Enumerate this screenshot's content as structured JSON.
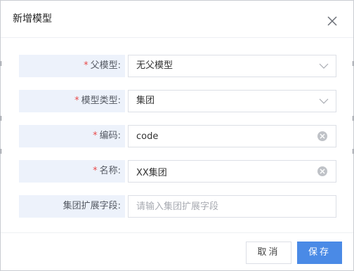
{
  "dialog": {
    "title": "新增模型",
    "close_icon": "close-icon"
  },
  "form": {
    "fields": [
      {
        "label": "父模型:",
        "required": "*",
        "type": "select",
        "value": "无父模型",
        "icon": "chevron-down-icon"
      },
      {
        "label": "模型类型:",
        "required": "*",
        "type": "select",
        "value": "集团",
        "icon": "chevron-down-icon"
      },
      {
        "label": "编码:",
        "required": "*",
        "type": "text",
        "value": "code",
        "icon": "clear-icon"
      },
      {
        "label": "名称:",
        "required": "*",
        "type": "text",
        "value": "XX集团",
        "icon": "clear-icon"
      },
      {
        "label": "集团扩展字段:",
        "type": "text",
        "value": "",
        "placeholder": "请输入集团扩展字段"
      }
    ]
  },
  "footer": {
    "cancel_label": "取消",
    "save_label": "保存"
  },
  "colors": {
    "primary": "#4a8ae6",
    "required": "#e84b4b",
    "label_background": "#edf2fb"
  }
}
